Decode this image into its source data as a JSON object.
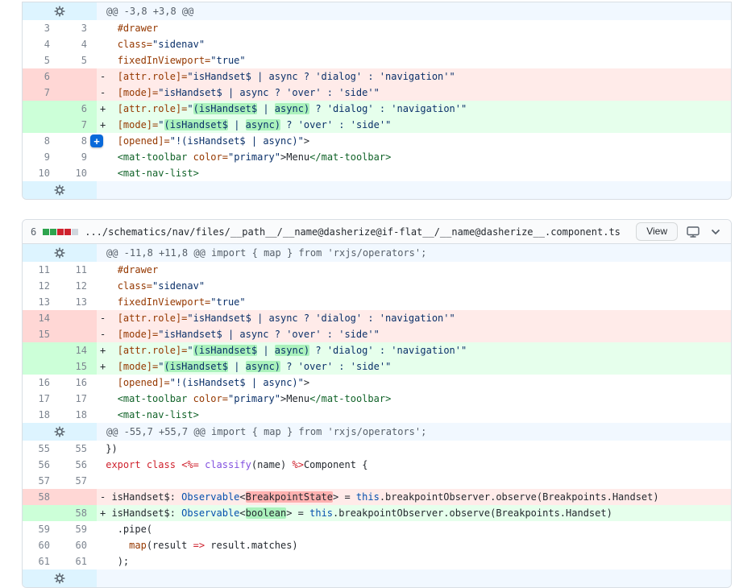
{
  "colors": {
    "addition_bg": "#e6ffec",
    "addition_gutter_bg": "#ccffd8",
    "addition_word_highlight": "#abf2bc",
    "deletion_bg": "#ffebe9",
    "deletion_gutter_bg": "#ffd7d5",
    "deletion_word_highlight": "#ff8182",
    "hunk_bg": "#f1f8ff",
    "hunk_gutter_bg": "#ddf4ff",
    "accent_blue": "#0969da",
    "diffstat_add": "#2da44e",
    "diffstat_del": "#cf222e"
  },
  "icons": {
    "expand_hunk": "gear-icon",
    "rich_diff": "monitor-icon",
    "collapse": "chevron-down-icon",
    "add_comment": "plus-icon"
  },
  "file_header": {
    "changed_count": "6",
    "diffstat": [
      "add",
      "add",
      "del",
      "del",
      "neutral"
    ],
    "path": ".../schematics/nav/files/__path__/__name@dasherize@if-flat__/__name@dasherize__.component.ts",
    "view_button_label": "View"
  },
  "blocks": [
    {
      "id": "block1",
      "rows": [
        {
          "type": "hunk",
          "text": "@@ -3,8 +3,8 @@"
        },
        {
          "type": "ctx",
          "old": "3",
          "new": "3",
          "indent": 2,
          "segs": [
            [
              "#drawer",
              "attr"
            ]
          ]
        },
        {
          "type": "ctx",
          "old": "4",
          "new": "4",
          "indent": 2,
          "segs": [
            [
              "class=",
              "attr"
            ],
            [
              "\"sidenav\"",
              "str"
            ]
          ]
        },
        {
          "type": "ctx",
          "old": "5",
          "new": "5",
          "indent": 2,
          "segs": [
            [
              "fixedInViewport=",
              "attr"
            ],
            [
              "\"true\"",
              "str"
            ]
          ]
        },
        {
          "type": "del",
          "old": "6",
          "indent": 2,
          "segs": [
            [
              "[attr.role]=",
              "attr"
            ],
            [
              "\"isHandset$ | async ? 'dialog' : 'navigation'\"",
              "str"
            ]
          ]
        },
        {
          "type": "del",
          "old": "7",
          "indent": 2,
          "segs": [
            [
              "[mode]=",
              "attr"
            ],
            [
              "\"isHandset$ | async ? 'over' : 'side'\"",
              "str"
            ]
          ]
        },
        {
          "type": "add",
          "new": "6",
          "indent": 2,
          "segs": [
            [
              "[attr.role]=",
              "attr"
            ],
            [
              "\"",
              "str"
            ],
            [
              "(isHandset$",
              "str hla"
            ],
            [
              " | ",
              "str"
            ],
            [
              "async)",
              "str hla"
            ],
            [
              " ? 'dialog' : 'navigation'\"",
              "str"
            ]
          ]
        },
        {
          "type": "add",
          "new": "7",
          "indent": 2,
          "segs": [
            [
              "[mode]=",
              "attr"
            ],
            [
              "\"",
              "str"
            ],
            [
              "(isHandset$",
              "str hla"
            ],
            [
              " | ",
              "str"
            ],
            [
              "async)",
              "str hla"
            ],
            [
              " ? 'over' : 'side'\"",
              "str"
            ]
          ]
        },
        {
          "type": "ctx",
          "old": "8",
          "new": "8",
          "indent": 2,
          "comment_btn": true,
          "segs": [
            [
              "[opened]=",
              "attr"
            ],
            [
              "\"!(isHandset$ | async)\"",
              "str"
            ],
            [
              ">",
              "plain"
            ]
          ]
        },
        {
          "type": "ctx",
          "old": "9",
          "new": "9",
          "indent": 2,
          "segs": [
            [
              "<mat-toolbar",
              "tag"
            ],
            [
              " ",
              "plain"
            ],
            [
              "color=",
              "attr"
            ],
            [
              "\"primary\"",
              "str"
            ],
            [
              ">",
              "plain"
            ],
            [
              "Menu",
              "plain"
            ],
            [
              "</mat-toolbar>",
              "tag"
            ]
          ]
        },
        {
          "type": "ctx",
          "old": "10",
          "new": "10",
          "indent": 2,
          "segs": [
            [
              "<mat-nav-list>",
              "tag"
            ]
          ]
        },
        {
          "type": "expand"
        }
      ]
    },
    {
      "id": "block2",
      "rows": [
        {
          "type": "hunk",
          "text": "@@ -11,8 +11,8 @@ import { map } from 'rxjs/operators';"
        },
        {
          "type": "ctx",
          "old": "11",
          "new": "11",
          "indent": 2,
          "segs": [
            [
              "#drawer",
              "attr"
            ]
          ]
        },
        {
          "type": "ctx",
          "old": "12",
          "new": "12",
          "indent": 2,
          "segs": [
            [
              "class=",
              "attr"
            ],
            [
              "\"sidenav\"",
              "str"
            ]
          ]
        },
        {
          "type": "ctx",
          "old": "13",
          "new": "13",
          "indent": 2,
          "segs": [
            [
              "fixedInViewport=",
              "attr"
            ],
            [
              "\"true\"",
              "str"
            ]
          ]
        },
        {
          "type": "del",
          "old": "14",
          "indent": 2,
          "segs": [
            [
              "[attr.role]=",
              "attr"
            ],
            [
              "\"isHandset$ | async ? 'dialog' : 'navigation'\"",
              "str"
            ]
          ]
        },
        {
          "type": "del",
          "old": "15",
          "indent": 2,
          "segs": [
            [
              "[mode]=",
              "attr"
            ],
            [
              "\"isHandset$ | async ? 'over' : 'side'\"",
              "str"
            ]
          ]
        },
        {
          "type": "add",
          "new": "14",
          "indent": 2,
          "segs": [
            [
              "[attr.role]=",
              "attr"
            ],
            [
              "\"",
              "str"
            ],
            [
              "(isHandset$",
              "str hla"
            ],
            [
              " | ",
              "str"
            ],
            [
              "async)",
              "str hla"
            ],
            [
              " ? 'dialog' : 'navigation'\"",
              "str"
            ]
          ]
        },
        {
          "type": "add",
          "new": "15",
          "indent": 2,
          "segs": [
            [
              "[mode]=",
              "attr"
            ],
            [
              "\"",
              "str"
            ],
            [
              "(isHandset$",
              "str hla"
            ],
            [
              " | ",
              "str"
            ],
            [
              "async)",
              "str hla"
            ],
            [
              " ? 'over' : 'side'\"",
              "str"
            ]
          ]
        },
        {
          "type": "ctx",
          "old": "16",
          "new": "16",
          "indent": 2,
          "segs": [
            [
              "[opened]=",
              "attr"
            ],
            [
              "\"!(isHandset$ | async)\"",
              "str"
            ],
            [
              ">",
              "plain"
            ]
          ]
        },
        {
          "type": "ctx",
          "old": "17",
          "new": "17",
          "indent": 2,
          "segs": [
            [
              "<mat-toolbar",
              "tag"
            ],
            [
              " ",
              "plain"
            ],
            [
              "color=",
              "attr"
            ],
            [
              "\"primary\"",
              "str"
            ],
            [
              ">",
              "plain"
            ],
            [
              "Menu",
              "plain"
            ],
            [
              "</mat-toolbar>",
              "tag"
            ]
          ]
        },
        {
          "type": "ctx",
          "old": "18",
          "new": "18",
          "indent": 2,
          "segs": [
            [
              "<mat-nav-list>",
              "tag"
            ]
          ]
        },
        {
          "type": "hunk",
          "text": "@@ -55,7 +55,7 @@ import { map } from 'rxjs/operators';"
        },
        {
          "type": "ctx",
          "old": "55",
          "new": "55",
          "indent": 0,
          "segs": [
            [
              "})",
              "plain"
            ]
          ]
        },
        {
          "type": "ctx",
          "old": "56",
          "new": "56",
          "indent": 0,
          "segs": [
            [
              "export",
              "kw"
            ],
            [
              " ",
              "plain"
            ],
            [
              "class",
              "kw"
            ],
            [
              " ",
              "plain"
            ],
            [
              "<%=",
              "kw"
            ],
            [
              " ",
              "plain"
            ],
            [
              "classify",
              "fn"
            ],
            [
              "(name)",
              "plain"
            ],
            [
              " ",
              "plain"
            ],
            [
              "%>",
              "kw"
            ],
            [
              "Component {",
              "plain"
            ]
          ]
        },
        {
          "type": "ctx",
          "old": "57",
          "new": "57",
          "indent": 0,
          "segs": []
        },
        {
          "type": "del",
          "old": "58",
          "indent": 1,
          "segs": [
            [
              "isHandset$: ",
              "plain"
            ],
            [
              "Observable",
              "type"
            ],
            [
              "<",
              "plain"
            ],
            [
              "BreakpointState",
              "plain hld"
            ],
            [
              "> = ",
              "plain"
            ],
            [
              "this",
              "type"
            ],
            [
              ".breakpointObserver.observe(Breakpoints.Handset)",
              "plain"
            ]
          ]
        },
        {
          "type": "add",
          "new": "58",
          "indent": 1,
          "segs": [
            [
              "isHandset$: ",
              "plain"
            ],
            [
              "Observable",
              "type"
            ],
            [
              "<",
              "plain"
            ],
            [
              "boolean",
              "plain hla"
            ],
            [
              "> = ",
              "plain"
            ],
            [
              "this",
              "type"
            ],
            [
              ".breakpointObserver.observe(Breakpoints.Handset)",
              "plain"
            ]
          ]
        },
        {
          "type": "ctx",
          "old": "59",
          "new": "59",
          "indent": 2,
          "segs": [
            [
              ".pipe(",
              "plain"
            ]
          ]
        },
        {
          "type": "ctx",
          "old": "60",
          "new": "60",
          "indent": 4,
          "segs": [
            [
              "map",
              "attr"
            ],
            [
              "(result ",
              "plain"
            ],
            [
              "=>",
              "kw"
            ],
            [
              " result.matches)",
              "plain"
            ]
          ]
        },
        {
          "type": "ctx",
          "old": "61",
          "new": "61",
          "indent": 2,
          "segs": [
            [
              ");",
              "plain"
            ]
          ]
        },
        {
          "type": "expand"
        }
      ]
    }
  ]
}
